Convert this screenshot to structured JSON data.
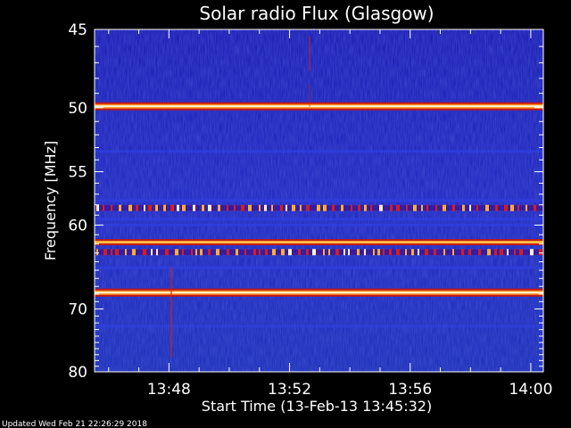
{
  "chart_data": {
    "type": "heatmap",
    "title": "Solar radio Flux (Glasgow)",
    "xlabel": "Start Time (13-Feb-13 13:45:32)",
    "ylabel": "Frequency [MHz]",
    "x_range": [
      "13:45:32",
      "14:00:25"
    ],
    "y_range": [
      45,
      80
    ],
    "y_ticks": [
      45,
      50,
      55,
      60,
      70,
      80
    ],
    "x_ticks": [
      "13:48",
      "13:52",
      "13:56",
      "14:00"
    ],
    "colormap": "blue-red-yellow-white",
    "background_color": "#1a1ab4",
    "emission_bands": [
      {
        "frequency": 49.9,
        "intensity": "very-high",
        "continuous": true
      },
      {
        "frequency": 58.3,
        "intensity": "high",
        "continuous": false
      },
      {
        "frequency": 61.8,
        "intensity": "high",
        "continuous": true
      },
      {
        "frequency": 62.9,
        "intensity": "high",
        "continuous": false
      },
      {
        "frequency": 67.8,
        "intensity": "very-high",
        "continuous": true
      }
    ],
    "weak_bands": [
      53.3,
      57.6,
      59.4,
      60.0,
      64.7,
      72.5
    ]
  },
  "footer": {
    "updated_text": "Updated Wed Feb 21 22:26:29 2018"
  }
}
